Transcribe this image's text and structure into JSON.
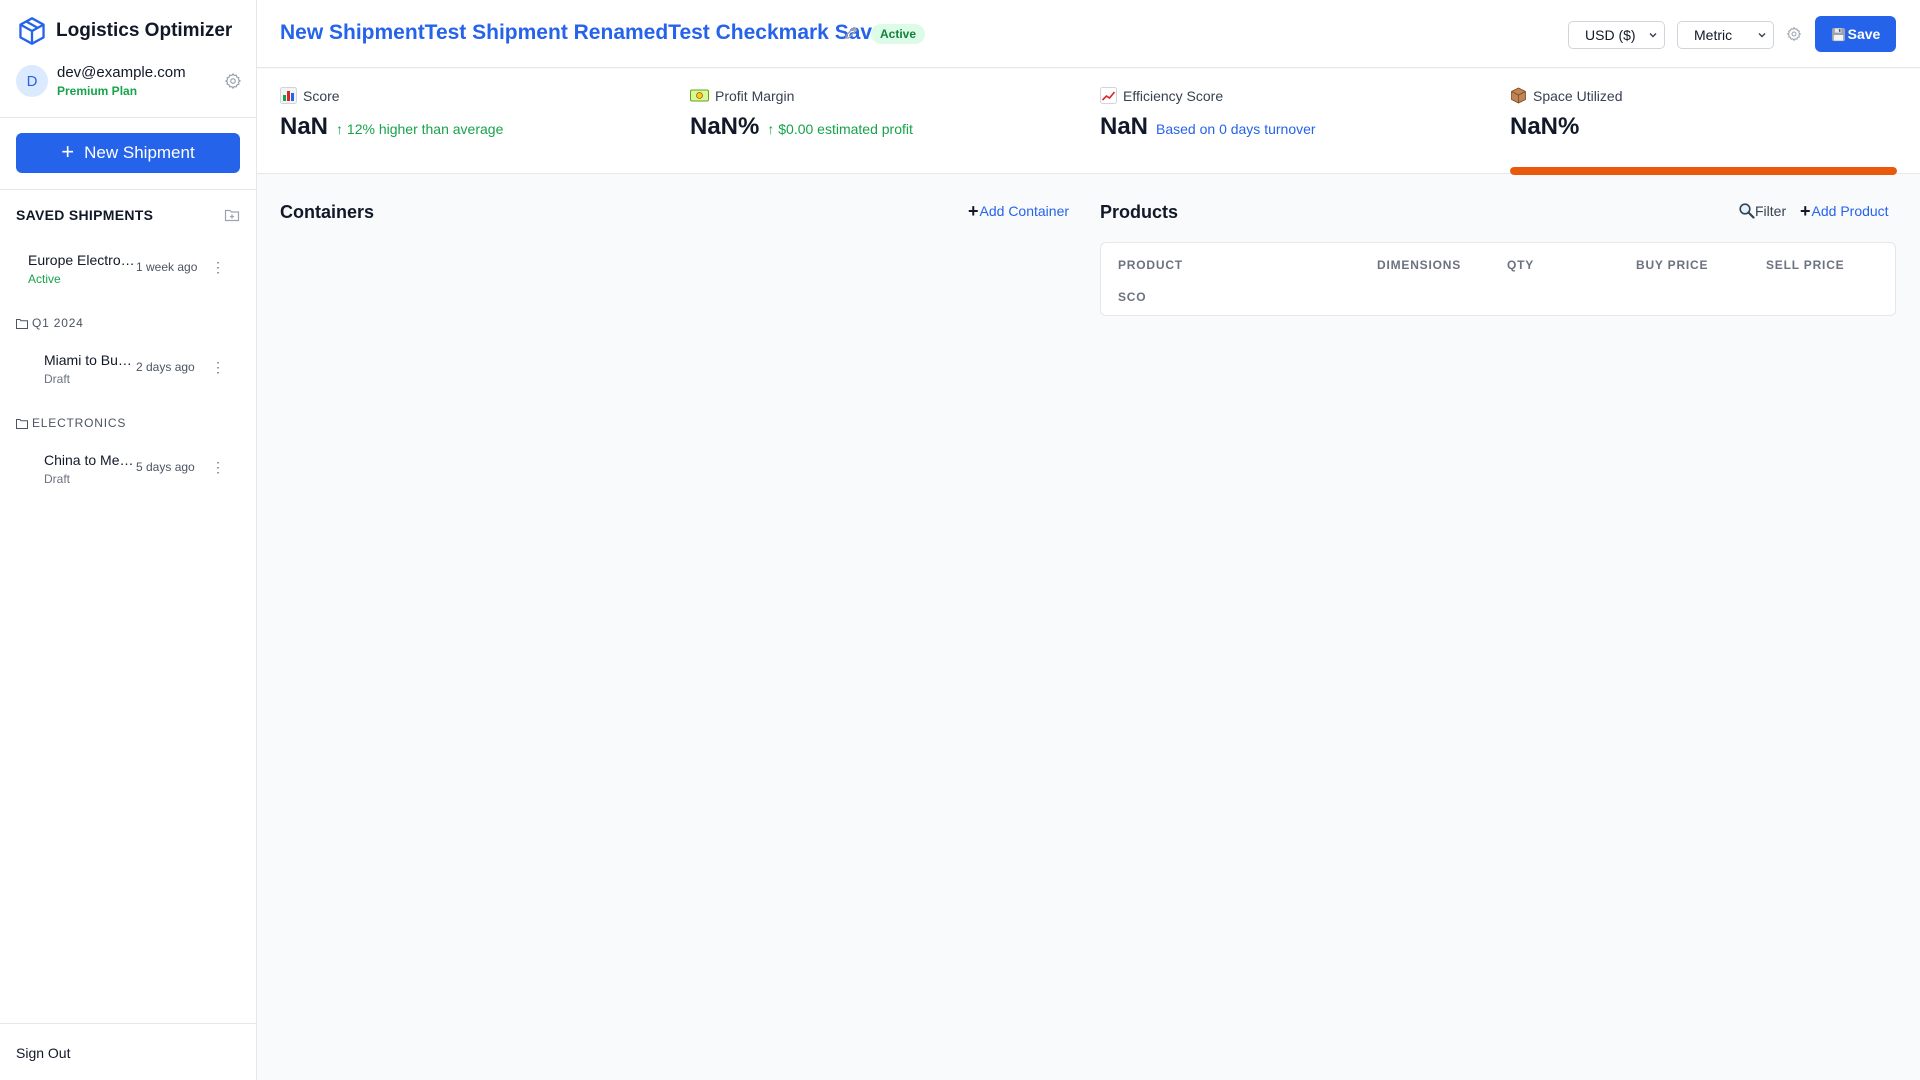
{
  "app": {
    "name": "Logistics Optimizer"
  },
  "user": {
    "initial": "D",
    "email": "dev@example.com",
    "plan": "Premium Plan"
  },
  "sidebar": {
    "new_shipment_label": "New Shipment",
    "saved_title": "SAVED SHIPMENTS",
    "shipments": [
      {
        "name": "Europe Electronics",
        "status": "Active",
        "time": "1 week ago"
      },
      {
        "name": "Miami to Buenos Aires",
        "status": "Draft",
        "time": "2 days ago"
      },
      {
        "name": "China to Mexico",
        "status": "Draft",
        "time": "5 days ago"
      }
    ],
    "folders": [
      {
        "name": "Q1 2024"
      },
      {
        "name": "ELECTRONICS"
      }
    ],
    "sign_out": "Sign Out"
  },
  "header": {
    "title": "New ShipmentTest Shipment RenamedTest Checkmark Save",
    "status": "Active",
    "currency": "USD ($)",
    "units": "Metric",
    "save_label": "Save"
  },
  "stats": {
    "score": {
      "label": "Score",
      "value": "NaN",
      "note": "↑ 12% higher than average"
    },
    "profit": {
      "label": "Profit Margin",
      "value": "NaN%",
      "note": "↑ $0.00 estimated profit"
    },
    "efficiency": {
      "label": "Efficiency Score",
      "value": "NaN",
      "note": "Based on 0 days turnover"
    },
    "space": {
      "label": "Space Utilized",
      "value": "NaN%",
      "progress": 1.0
    }
  },
  "containers": {
    "title": "Containers",
    "add_label": "Add Container"
  },
  "products": {
    "title": "Products",
    "filter_label": "Filter",
    "add_label": "Add Product",
    "columns": [
      "PRODUCT",
      "DIMENSIONS",
      "QTY",
      "BUY PRICE",
      "SELL PRICE",
      "SCO"
    ]
  },
  "colors": {
    "accent": "#2563eb",
    "success": "#16a34a",
    "progress": "#ea580c"
  }
}
